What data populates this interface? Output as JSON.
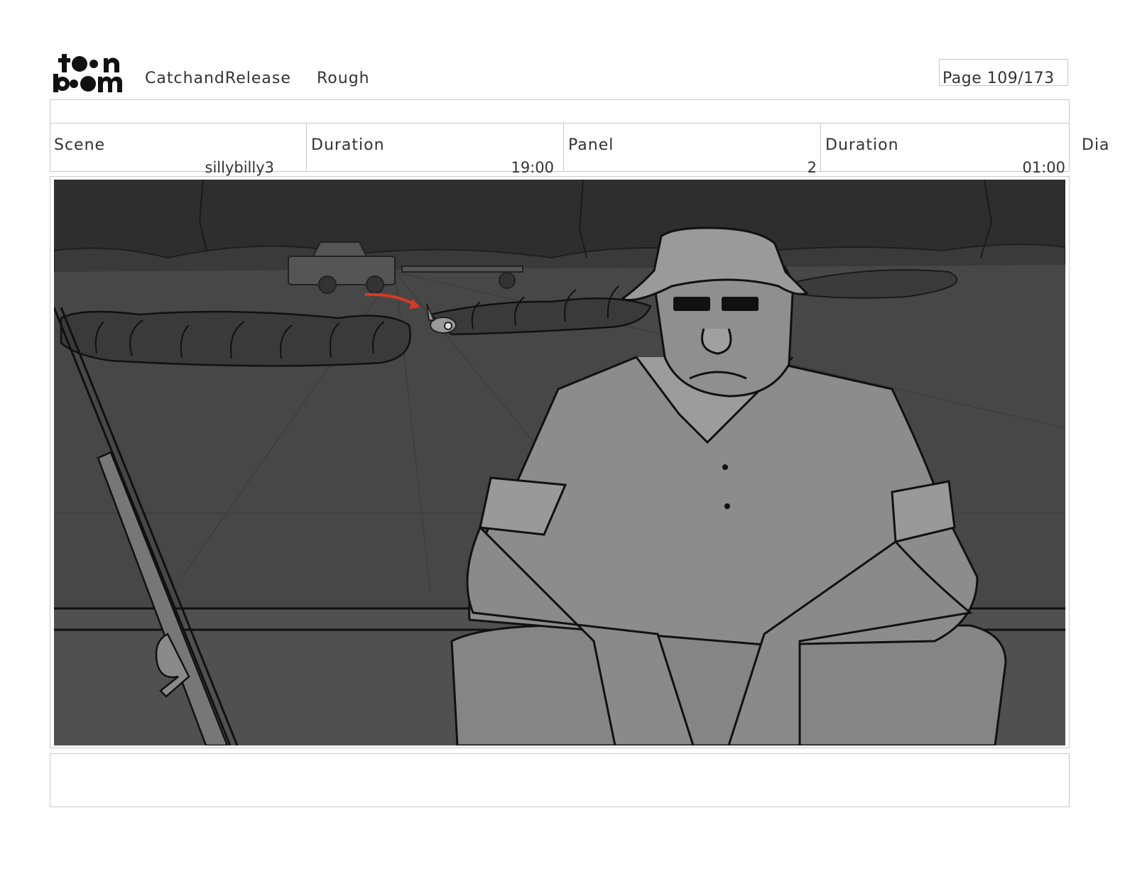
{
  "header": {
    "logo_text": "toon boom",
    "project": "CatchandRelease",
    "stage": "Rough",
    "page": "Page 109/173"
  },
  "info": {
    "scene_label": "Scene",
    "scene_value": "sillybilly3",
    "scene_duration_label": "Duration",
    "scene_duration_value": "19:00",
    "panel_label": "Panel",
    "panel_value": "2",
    "panel_duration_label": "Duration",
    "panel_duration_value": "01:00",
    "dialog_label": "Dia"
  },
  "colors": {
    "sky": "#2f2f2f",
    "ground": "#484848",
    "figure": "#8a8a8a",
    "arrow": "#d83a22"
  }
}
